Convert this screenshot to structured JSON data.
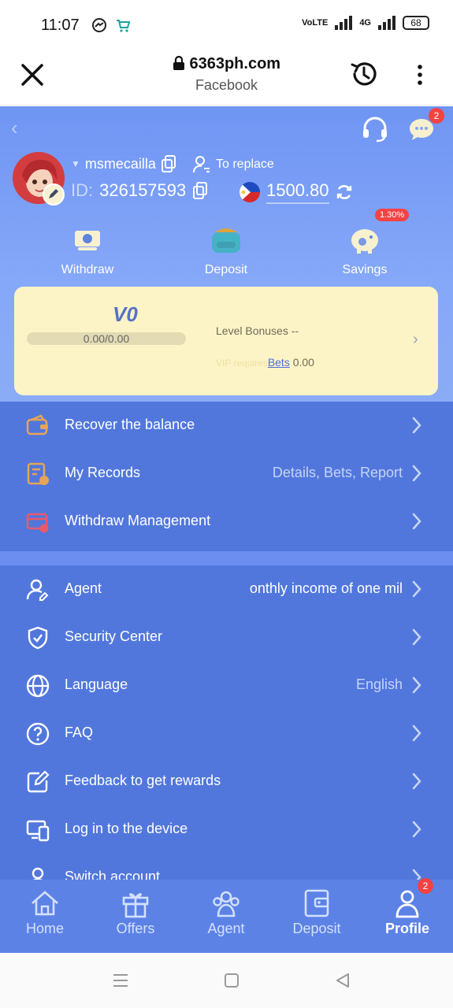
{
  "status_bar": {
    "time": "11:07",
    "network": "4G",
    "battery": "68"
  },
  "browser": {
    "url": "6363ph.com",
    "subtitle": "Facebook"
  },
  "header": {
    "chat_badge": "2",
    "username": "msmecailla",
    "replace_label": "To replace",
    "id_label": "ID:",
    "id_value": "326157593",
    "balance": "1500.80"
  },
  "quick_actions": [
    {
      "label": "Withdraw",
      "icon": "withdraw-icon"
    },
    {
      "label": "Deposit",
      "icon": "wallet-icon"
    },
    {
      "label": "Savings",
      "icon": "piggy-bank-icon",
      "badge": "1.30%"
    }
  ],
  "vip": {
    "level": "V0",
    "progress_text": "0.00/0.00",
    "progress": 0,
    "bonus_label": "Level Bonuses --",
    "requires_label": "VIP requires",
    "requires_link": "Bets",
    "requires_value": "0.00"
  },
  "menu_group1": [
    {
      "label": "Recover the balance",
      "value": "",
      "icon": "wallet-recover-icon"
    },
    {
      "label": "My Records",
      "value": "Details, Bets, Report",
      "icon": "records-icon"
    },
    {
      "label": "Withdraw Management",
      "value": "",
      "icon": "card-manage-icon"
    }
  ],
  "menu_group2": [
    {
      "label": "Agent",
      "value": "onthly income of one mil",
      "icon": "agent-icon"
    },
    {
      "label": "Security Center",
      "value": "",
      "icon": "shield-icon"
    },
    {
      "label": "Language",
      "value": "English",
      "icon": "globe-icon"
    },
    {
      "label": "FAQ",
      "value": "",
      "icon": "question-icon"
    },
    {
      "label": "Feedback to get rewards",
      "value": "",
      "icon": "edit-icon"
    },
    {
      "label": "Log in to the device",
      "value": "",
      "icon": "device-icon"
    },
    {
      "label": "Switch account",
      "value": "",
      "icon": "user-icon"
    }
  ],
  "tabs": [
    {
      "label": "Home",
      "icon": "home-icon"
    },
    {
      "label": "Offers",
      "icon": "gift-icon"
    },
    {
      "label": "Agent",
      "icon": "people-icon"
    },
    {
      "label": "Deposit",
      "icon": "wallet-icon"
    },
    {
      "label": "Profile",
      "icon": "profile-icon",
      "badge": "2"
    }
  ],
  "colors": {
    "app_blue": "#5277dc",
    "header_blue": "#86a8f8",
    "vip_card": "#fcf4c7",
    "badge_red": "#f24343"
  }
}
